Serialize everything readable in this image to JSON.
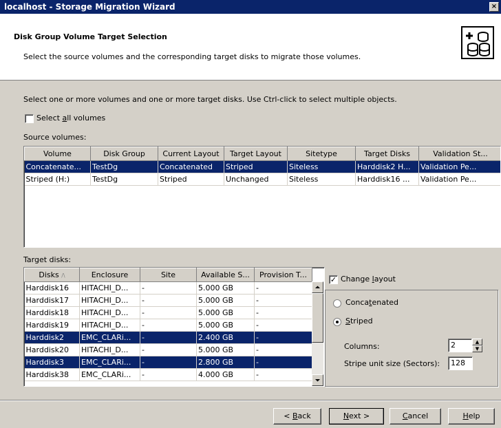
{
  "window": {
    "title": "localhost - Storage Migration Wizard",
    "close_glyph": "×"
  },
  "header": {
    "title": "Disk Group Volume Target Selection",
    "subtitle": "Select the source volumes and the corresponding target disks to migrate those volumes."
  },
  "instructions": "Select one or more volumes and one or more target disks. Use Ctrl-click to select multiple objects.",
  "select_all": {
    "label_pre": "Select ",
    "label_key": "a",
    "label_post": "ll volumes",
    "checked": false
  },
  "source": {
    "label": "Source volumes:",
    "columns": [
      "Volume",
      "Disk Group",
      "Current Layout",
      "Target Layout",
      "Sitetype",
      "Target Disks",
      "Validation St..."
    ],
    "rows": [
      {
        "selected": true,
        "cells": [
          "Concatenate...",
          "TestDg",
          "Concatenated",
          "Striped",
          "Siteless",
          "Harddisk2 H...",
          "Validation Pe..."
        ]
      },
      {
        "selected": false,
        "cells": [
          "Striped (H:)",
          "TestDg",
          "Striped",
          "Unchanged",
          "Siteless",
          "Harddisk16 ...",
          "Validation Pe..."
        ]
      }
    ]
  },
  "targets": {
    "label": "Target disks:",
    "columns": [
      "Disks",
      "Enclosure",
      "Site",
      "Available S...",
      "Provision T..."
    ],
    "sort_glyph": "/\\",
    "rows": [
      {
        "selected": false,
        "cells": [
          "Harddisk16",
          "HITACHI_D...",
          "-",
          "5.000 GB",
          "-"
        ]
      },
      {
        "selected": false,
        "cells": [
          "Harddisk17",
          "HITACHI_D...",
          "-",
          "5.000 GB",
          "-"
        ]
      },
      {
        "selected": false,
        "cells": [
          "Harddisk18",
          "HITACHI_D...",
          "-",
          "5.000 GB",
          "-"
        ]
      },
      {
        "selected": false,
        "cells": [
          "Harddisk19",
          "HITACHI_D...",
          "-",
          "5.000 GB",
          "-"
        ]
      },
      {
        "selected": true,
        "cells": [
          "Harddisk2",
          "EMC_CLARi...",
          "-",
          "2.400 GB",
          "-"
        ]
      },
      {
        "selected": false,
        "cells": [
          "Harddisk20",
          "HITACHI_D...",
          "-",
          "5.000 GB",
          "-"
        ]
      },
      {
        "selected": true,
        "cells": [
          "Harddisk3",
          "EMC_CLARi...",
          "-",
          "2.800 GB",
          "-"
        ]
      },
      {
        "selected": false,
        "cells": [
          "Harddisk38",
          "EMC_CLARi...",
          "-",
          "4.000 GB",
          "-"
        ]
      }
    ]
  },
  "layout": {
    "change_layout": {
      "pre": "Change ",
      "key": "l",
      "post": "ayout",
      "checked": true,
      "check_glyph": "✓"
    },
    "concatenated": {
      "pre": "Conca",
      "key": "t",
      "post": "enated",
      "selected": false
    },
    "striped": {
      "pre": "",
      "key": "S",
      "post": "triped",
      "selected": true
    },
    "columns_label": "Columns:",
    "columns_value": "2",
    "stripe_label": "Stripe unit size (Sectors):",
    "stripe_value": "128"
  },
  "buttons": {
    "back": {
      "pre": "< ",
      "key": "B",
      "post": "ack"
    },
    "next": {
      "pre": "",
      "key": "N",
      "post": "ext >"
    },
    "cancel": {
      "pre": "",
      "key": "C",
      "post": "ancel"
    },
    "help": {
      "pre": "",
      "key": "H",
      "post": "elp"
    }
  }
}
